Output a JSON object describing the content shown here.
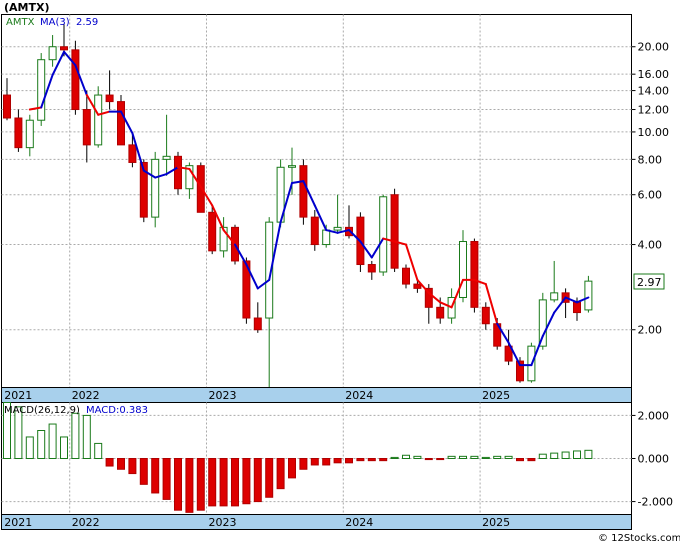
{
  "chart_data": [
    {
      "type": "candlestick",
      "ticker": "(AMTX)",
      "legend": {
        "symbol": "AMTX",
        "ma_label": "MA(3)",
        "ma_value": "2.59"
      },
      "scale": "log",
      "ylim": [
        1.25,
        26
      ],
      "yticks": [
        "20.00",
        "16.00",
        "14.00",
        "12.00",
        "10.00",
        "8.00",
        "6.00",
        "4.00",
        "2.00"
      ],
      "ytick_values": [
        20,
        16,
        14,
        12,
        10,
        8,
        6,
        4,
        2
      ],
      "x_labels": [
        "2021",
        "2022",
        "2023",
        "2024",
        "2025"
      ],
      "x_label_index": [
        0,
        6,
        18,
        30,
        42
      ],
      "last_price": "2.97",
      "colors": {
        "up": "#1a7a1a",
        "down": "#dd0000",
        "ma": "#0000cc",
        "ma_alt": "#ee0000",
        "grid": "#aaaaaa",
        "axis_band": "#a8d0ec"
      },
      "candles": [
        [
          13.5,
          15.5,
          11.0,
          11.2
        ],
        [
          11.2,
          12.0,
          8.5,
          8.8
        ],
        [
          8.8,
          11.5,
          8.2,
          11.0
        ],
        [
          11.0,
          19.0,
          10.5,
          18.0
        ],
        [
          18.0,
          22.0,
          17.0,
          20.0
        ],
        [
          20.0,
          24.0,
          18.5,
          19.5
        ],
        [
          19.5,
          21.0,
          11.5,
          12.0
        ],
        [
          12.0,
          14.0,
          7.8,
          9.0
        ],
        [
          9.0,
          14.5,
          8.8,
          13.5
        ],
        [
          13.5,
          16.5,
          12.0,
          12.8
        ],
        [
          12.8,
          13.5,
          9.0,
          9.0
        ],
        [
          9.0,
          10.0,
          7.5,
          7.8
        ],
        [
          7.8,
          8.0,
          4.8,
          5.0
        ],
        [
          5.0,
          8.5,
          4.6,
          8.0
        ],
        [
          8.0,
          11.5,
          7.0,
          8.2
        ],
        [
          8.2,
          8.5,
          6.0,
          6.3
        ],
        [
          6.3,
          7.8,
          5.8,
          7.6
        ],
        [
          7.6,
          7.8,
          5.2,
          5.2
        ],
        [
          5.2,
          5.5,
          3.7,
          3.8
        ],
        [
          3.8,
          5.0,
          3.6,
          4.6
        ],
        [
          4.6,
          4.7,
          3.4,
          3.5
        ],
        [
          3.5,
          3.6,
          2.1,
          2.2
        ],
        [
          2.2,
          2.5,
          1.95,
          2.0
        ],
        [
          2.2,
          5.0,
          1.25,
          4.8
        ],
        [
          4.8,
          8.0,
          4.6,
          7.5
        ],
        [
          7.5,
          8.8,
          6.0,
          7.6
        ],
        [
          7.6,
          8.0,
          4.7,
          5.0
        ],
        [
          5.0,
          5.3,
          3.8,
          4.0
        ],
        [
          4.0,
          4.7,
          3.9,
          4.5
        ],
        [
          4.5,
          6.0,
          4.4,
          4.6
        ],
        [
          4.6,
          5.5,
          4.2,
          4.3
        ],
        [
          5.0,
          5.2,
          3.2,
          3.4
        ],
        [
          3.4,
          3.5,
          3.0,
          3.2
        ],
        [
          3.2,
          6.0,
          3.1,
          5.9
        ],
        [
          6.0,
          6.3,
          3.2,
          3.3
        ],
        [
          3.3,
          3.4,
          2.8,
          2.9
        ],
        [
          2.9,
          3.0,
          2.7,
          2.8
        ],
        [
          2.8,
          2.9,
          2.1,
          2.4
        ],
        [
          2.4,
          2.6,
          2.1,
          2.2
        ],
        [
          2.2,
          2.8,
          2.1,
          2.6
        ],
        [
          2.6,
          4.5,
          2.5,
          4.1
        ],
        [
          4.1,
          4.2,
          2.3,
          2.4
        ],
        [
          2.4,
          2.5,
          2.0,
          2.1
        ],
        [
          2.1,
          2.2,
          1.7,
          1.75
        ],
        [
          1.75,
          2.0,
          1.5,
          1.55
        ],
        [
          1.55,
          1.6,
          1.3,
          1.32
        ],
        [
          1.32,
          1.8,
          1.3,
          1.75
        ],
        [
          1.75,
          2.7,
          1.7,
          2.55
        ],
        [
          2.55,
          3.5,
          2.5,
          2.7
        ],
        [
          2.7,
          2.8,
          2.2,
          2.5
        ],
        [
          2.5,
          2.6,
          2.15,
          2.3
        ],
        [
          2.35,
          3.1,
          2.3,
          2.97
        ]
      ],
      "ma_values": [
        null,
        null,
        12.0,
        12.2,
        15.9,
        19.2,
        17.2,
        13.5,
        11.5,
        11.8,
        11.8,
        9.9,
        7.3,
        6.9,
        7.1,
        7.5,
        7.4,
        6.4,
        5.5,
        4.5,
        4.0,
        3.4,
        2.8,
        3.0,
        4.8,
        6.6,
        6.7,
        5.5,
        4.5,
        4.4,
        4.5,
        4.1,
        3.6,
        4.2,
        4.1,
        4.0,
        3.0,
        2.7,
        2.5,
        2.4,
        3.0,
        3.0,
        2.9,
        2.1,
        1.8,
        1.5,
        1.5,
        1.9,
        2.3,
        2.6,
        2.5,
        2.6
      ],
      "ma_red_segments": [
        [
          0,
          3
        ],
        [
          7,
          9
        ],
        [
          15,
          20
        ],
        [
          33,
          43
        ]
      ]
    },
    {
      "type": "bar",
      "title": "MACD(26,12,9)",
      "macd_label": "MACD:0.383",
      "ylim": [
        -2.6,
        2.6
      ],
      "yticks": [
        "2.000",
        "0.000",
        "-2.000"
      ],
      "ytick_values": [
        2,
        0,
        -2
      ],
      "x_labels": [
        "2021",
        "2022",
        "2023",
        "2024",
        "2025"
      ],
      "values": [
        2.6,
        2.4,
        1.0,
        1.3,
        1.6,
        1.0,
        2.1,
        2.0,
        0.7,
        -0.35,
        -0.5,
        -0.7,
        -1.2,
        -1.6,
        -1.9,
        -2.4,
        -2.5,
        -2.4,
        -2.2,
        -2.2,
        -2.2,
        -2.1,
        -2.0,
        -1.8,
        -1.4,
        -0.9,
        -0.5,
        -0.3,
        -0.3,
        -0.2,
        -0.2,
        -0.1,
        -0.1,
        -0.1,
        0.05,
        0.15,
        0.1,
        -0.05,
        -0.05,
        0.1,
        0.1,
        0.1,
        0.05,
        0.1,
        0.1,
        -0.1,
        -0.1,
        0.2,
        0.25,
        0.3,
        0.35,
        0.38
      ]
    }
  ],
  "footer": {
    "copyright": "© 12Stocks.com"
  }
}
